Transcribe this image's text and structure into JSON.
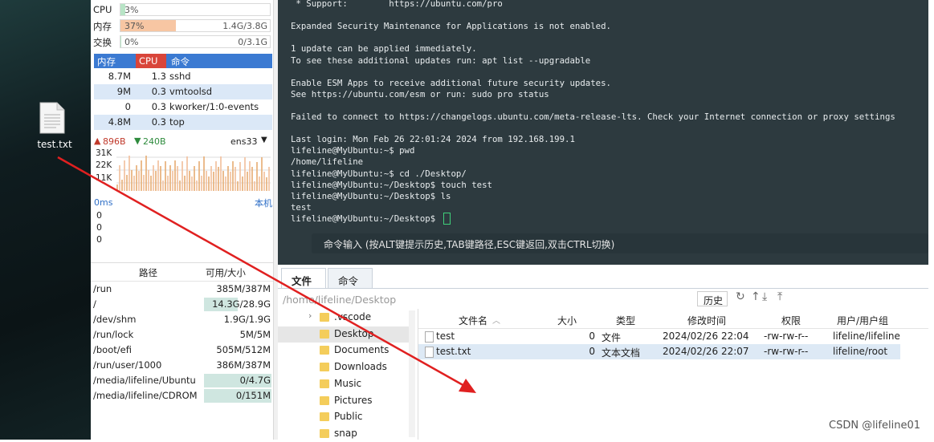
{
  "desktop": {
    "file_name": "test.txt"
  },
  "system": {
    "metrics": [
      {
        "label": "CPU",
        "percent": "3%",
        "amount": "",
        "fill": 0.03,
        "color": "#b8e4c6"
      },
      {
        "label": "内存",
        "percent": "37%",
        "amount": "1.4G/3.8G",
        "fill": 0.37,
        "color": "#f7c6a3"
      },
      {
        "label": "交换",
        "percent": "0%",
        "amount": "0/3.1G",
        "fill": 0.0,
        "color": "#b8e4c6"
      }
    ],
    "process_header": {
      "mem": "内存",
      "cpu": "CPU",
      "cmd": "命令"
    },
    "processes": [
      {
        "mem": "8.7M",
        "cpu": "1.3",
        "cmd": "sshd"
      },
      {
        "mem": "9M",
        "cpu": "0.3",
        "cmd": "vmtoolsd"
      },
      {
        "mem": "0",
        "cpu": "0.3",
        "cmd": "kworker/1:0-events"
      },
      {
        "mem": "4.8M",
        "cpu": "0.3",
        "cmd": "top"
      }
    ],
    "network": {
      "up": "896B",
      "down": "240B",
      "iface": "ens33",
      "y_ticks": [
        "31K",
        "22K",
        "11K"
      ]
    },
    "latency": {
      "value": "0ms",
      "host": "本机",
      "rows": [
        "0",
        "0",
        "0"
      ]
    },
    "disk_header": {
      "path": "路径",
      "cap": "可用/大小"
    },
    "disks": [
      {
        "path": "/run",
        "cap": "385M/387M",
        "fill": 0.0
      },
      {
        "path": "/",
        "cap": "14.3G/28.9G",
        "fill": 0.5
      },
      {
        "path": "/dev/shm",
        "cap": "1.9G/1.9G",
        "fill": 0.0
      },
      {
        "path": "/run/lock",
        "cap": "5M/5M",
        "fill": 0.0
      },
      {
        "path": "/boot/efi",
        "cap": "505M/512M",
        "fill": 0.0
      },
      {
        "path": "/run/user/1000",
        "cap": "386M/387M",
        "fill": 0.0
      },
      {
        "path": "/media/lifeline/Ubuntu",
        "cap": "0/4.7G",
        "fill": 1.0
      },
      {
        "path": "/media/lifeline/CDROM",
        "cap": "0/151M",
        "fill": 1.0
      }
    ]
  },
  "terminal": {
    "lines": [
      " * Support:        https://ubuntu.com/pro",
      "",
      "Expanded Security Maintenance for Applications is not enabled.",
      "",
      "1 update can be applied immediately.",
      "To see these additional updates run: apt list --upgradable",
      "",
      "Enable ESM Apps to receive additional future security updates.",
      "See https://ubuntu.com/esm or run: sudo pro status",
      "",
      "Failed to connect to https://changelogs.ubuntu.com/meta-release-lts. Check your Internet connection or proxy settings",
      "",
      "Last login: Mon Feb 26 22:01:24 2024 from 192.168.199.1",
      "lifeline@MyUbuntu:~$ pwd",
      "/home/lifeline",
      "lifeline@MyUbuntu:~$ cd ./Desktop/",
      "lifeline@MyUbuntu:~/Desktop$ touch test",
      "lifeline@MyUbuntu:~/Desktop$ ls",
      "test",
      "lifeline@MyUbuntu:~/Desktop$ "
    ],
    "command_hint": "命令输入 (按ALT键提示历史,TAB键路径,ESC键返回,双击CTRL切换)"
  },
  "file_manager": {
    "tabs": [
      "文件",
      "命令"
    ],
    "path": "/home/lifeline/Desktop",
    "history_button": "历史",
    "tree": [
      ".vscode",
      "Desktop",
      "Documents",
      "Downloads",
      "Music",
      "Pictures",
      "Public",
      "snap"
    ],
    "columns": [
      "文件名",
      "大小",
      "类型",
      "修改时间",
      "权限",
      "用户/用户组"
    ],
    "files": [
      {
        "name": "test",
        "size": "0",
        "type": "文件",
        "mtime": "2024/02/26 22:04",
        "perm": "-rw-rw-r--",
        "owner": "lifeline/lifeline"
      },
      {
        "name": "test.txt",
        "size": "0",
        "type": "文本文档",
        "mtime": "2024/02/26 22:07",
        "perm": "-rw-rw-r--",
        "owner": "lifeline/root"
      }
    ]
  },
  "watermark": "CSDN @lifeline01"
}
